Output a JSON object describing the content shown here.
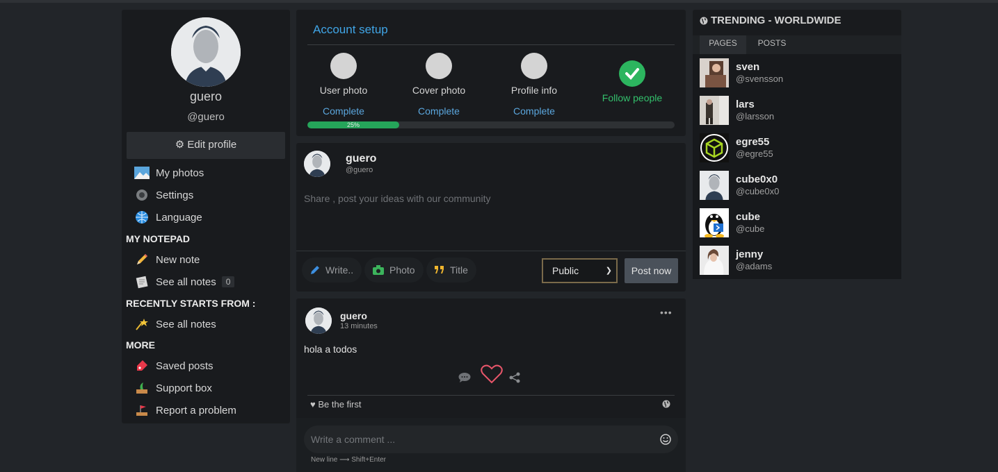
{
  "profile": {
    "name": "guero",
    "handle": "@guero",
    "edit_label": "Edit profile"
  },
  "sidebar": {
    "items": [
      {
        "label": "My photos",
        "icon": "photos-icon"
      },
      {
        "label": "Settings",
        "icon": "gear-icon"
      },
      {
        "label": "Language",
        "icon": "globe-icon"
      }
    ],
    "notepad_title": "MY NOTEPAD",
    "notepad_items": [
      {
        "label": "New note",
        "icon": "pencil-icon"
      },
      {
        "label": "See all notes",
        "icon": "notes-icon",
        "count": "0"
      }
    ],
    "recent_title": "RECENTLY STARTS FROM :",
    "recent_items": [
      {
        "label": "See all notes",
        "icon": "shooting-star-icon"
      }
    ],
    "more_title": "MORE",
    "more_items": [
      {
        "label": "Saved posts",
        "icon": "tag-icon"
      },
      {
        "label": "Support box",
        "icon": "support-icon"
      },
      {
        "label": "Report a problem",
        "icon": "flag-icon"
      }
    ]
  },
  "setup": {
    "title": "Account setup",
    "steps": [
      {
        "label": "User photo",
        "status": "Complete"
      },
      {
        "label": "Cover photo",
        "status": "Complete"
      },
      {
        "label": "Profile info",
        "status": "Complete"
      },
      {
        "label": "Follow people",
        "status": ""
      }
    ],
    "progress_label": "25%",
    "progress": 0.25
  },
  "composer": {
    "name": "guero",
    "handle": "@guero",
    "placeholder": "Share , post your ideas with our community",
    "tools": [
      "Write..",
      "Photo",
      "Title"
    ],
    "privacy": "Public",
    "post_label": "Post now"
  },
  "post": {
    "author": "guero",
    "time": "13 minutes",
    "text": "hola a todos",
    "likes_label": "Be the first",
    "comment_placeholder": "Write a comment ...",
    "hint": "New line ⟶ Shift+Enter"
  },
  "trending": {
    "title": "TRENDING - WORLDWIDE",
    "tabs": [
      "PAGES",
      "POSTS"
    ],
    "items": [
      {
        "name": "sven",
        "handle": "@svensson"
      },
      {
        "name": "lars",
        "handle": "@larsson"
      },
      {
        "name": "egre55",
        "handle": "@egre55"
      },
      {
        "name": "cube0x0",
        "handle": "@cube0x0"
      },
      {
        "name": "cube",
        "handle": "@cube"
      },
      {
        "name": "jenny",
        "handle": "@adams"
      }
    ]
  },
  "colors": {
    "accent": "#40a5e6",
    "success": "#2cb55f",
    "background": "#222529",
    "panel": "#191b1e"
  }
}
